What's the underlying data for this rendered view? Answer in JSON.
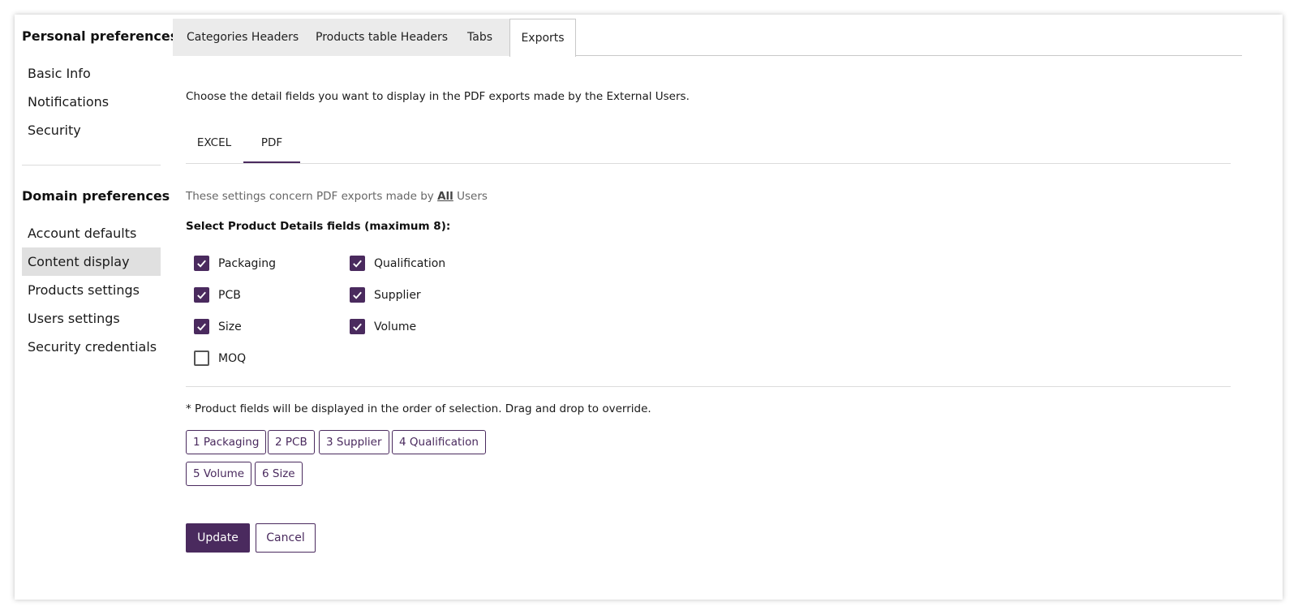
{
  "sidebar": {
    "personal_title": "Personal preferences",
    "personal_items": [
      "Basic Info",
      "Notifications",
      "Security"
    ],
    "domain_title": "Domain preferences",
    "domain_items": [
      "Account defaults",
      "Content display",
      "Products settings",
      "Users settings",
      "Security credentials"
    ],
    "active_item": "Content display"
  },
  "tabs": [
    "Categories Headers",
    "Products table Headers",
    "Tabs",
    "Exports"
  ],
  "active_tab": "Exports",
  "intro": "Choose the detail fields you want to display in the PDF exports made by the External Users.",
  "subtabs": [
    "EXCEL",
    "PDF"
  ],
  "active_subtab": "PDF",
  "note": {
    "prefix": "These settings concern PDF exports made by",
    "emphasis": "All",
    "suffix": "Users"
  },
  "select_title": "Select Product Details fields (maximum 8):",
  "fields": [
    {
      "label": "Packaging",
      "checked": true
    },
    {
      "label": "PCB",
      "checked": true
    },
    {
      "label": "Size",
      "checked": true
    },
    {
      "label": "MOQ",
      "checked": false
    },
    {
      "label": "Qualification",
      "checked": true
    },
    {
      "label": "Supplier",
      "checked": true
    },
    {
      "label": "Volume",
      "checked": true
    }
  ],
  "order_note": "* Product fields will be displayed in the order of selection. Drag and drop to override.",
  "order_chips": [
    "1 Packaging",
    "2 PCB",
    "3 Supplier",
    "4 Qualification",
    "5 Volume",
    "6 Size"
  ],
  "buttons": {
    "update": "Update",
    "cancel": "Cancel"
  },
  "colors": {
    "accent": "#4a2a5e",
    "active_bg": "#e0e0e0",
    "tab_bg": "#ebebeb"
  }
}
